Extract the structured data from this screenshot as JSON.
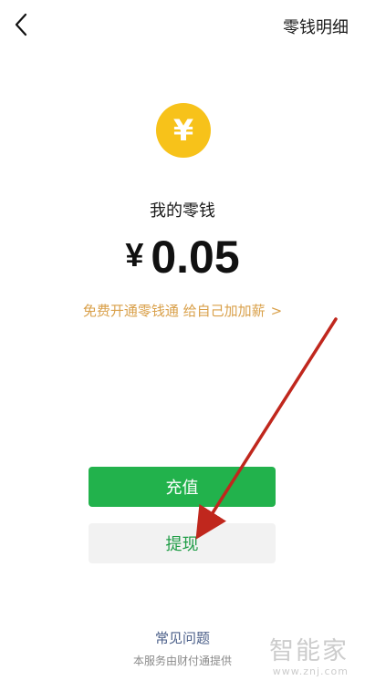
{
  "header": {
    "back_icon": "chevron-left-icon",
    "detail_label": "零钱明细"
  },
  "wallet": {
    "coin_symbol": "¥",
    "coin_color": "#f7c21a",
    "label": "我的零钱",
    "currency": "¥",
    "amount": "0.05",
    "promo_text": "免费开通零钱通 给自己加加薪",
    "promo_chevron": ">",
    "promo_color": "#d9a04a"
  },
  "actions": {
    "recharge_label": "充值",
    "withdraw_label": "提现",
    "recharge_color": "#22b24c"
  },
  "footer": {
    "faq_label": "常见问题",
    "provider_text": "本服务由财付通提供"
  },
  "watermark": {
    "name": "智能家",
    "url": "www.znj.com"
  },
  "annotation": {
    "arrow_color": "#c0271d"
  }
}
